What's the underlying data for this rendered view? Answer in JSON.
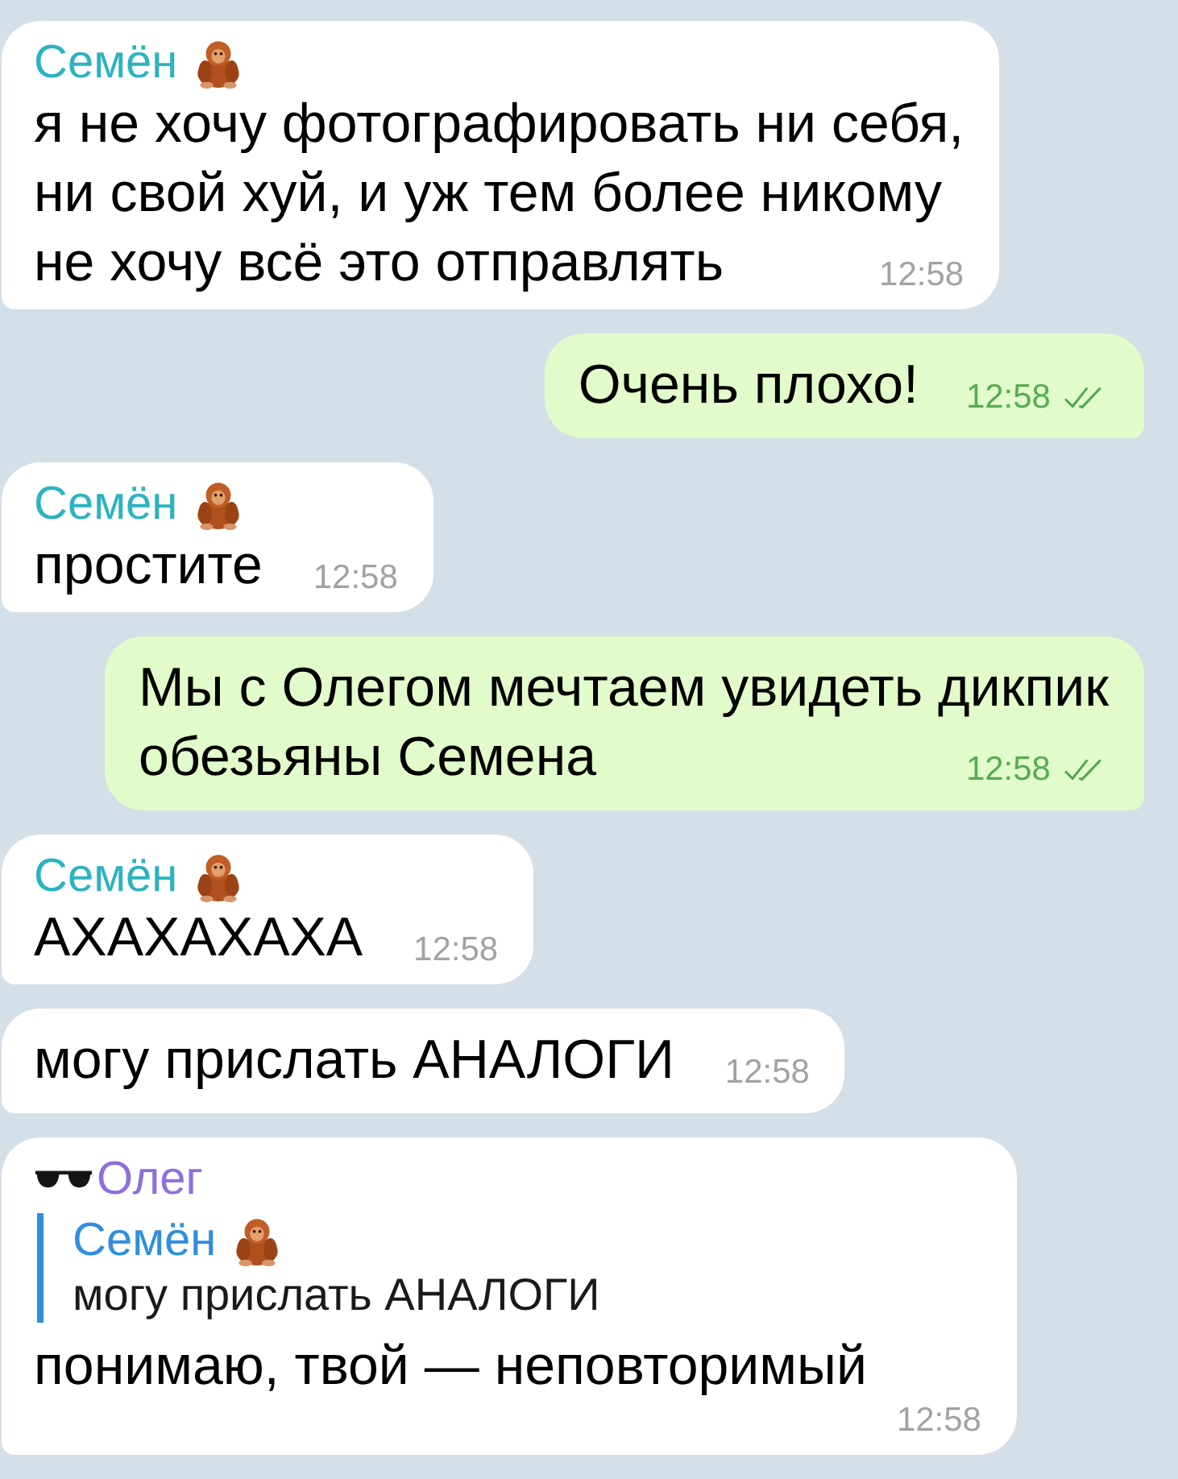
{
  "chat": {
    "messages": [
      {
        "kind": "incoming",
        "sender": {
          "name": "Семён",
          "color": "#2bb3c1",
          "kind": "orangutan"
        },
        "text": "я не хочу фотографировать ни себя,\nни свой хуй, и уж тем более никому\nне хочу всё это отправлять",
        "time": "12:58"
      },
      {
        "kind": "outgoing",
        "text": "Очень плохо!",
        "time": "12:58",
        "read": true
      },
      {
        "kind": "incoming",
        "sender": {
          "name": "Семён",
          "color": "#2bb3c1",
          "kind": "orangutan"
        },
        "text": "простите",
        "time": "12:58"
      },
      {
        "kind": "outgoing",
        "text": "Мы с Олегом мечтаем увидеть дикпик\nобезьяны Семена",
        "time": "12:58",
        "read": true
      },
      {
        "kind": "incoming",
        "sender": {
          "name": "Семён",
          "color": "#2bb3c1",
          "kind": "orangutan"
        },
        "text": "АХАХАХАХА",
        "time": "12:58"
      },
      {
        "kind": "incoming",
        "text": "могу прислать АНАЛОГИ",
        "time": "12:58"
      },
      {
        "kind": "incoming",
        "sender": {
          "name": "Олег",
          "color": "#8e6ee0",
          "kind": "sunglasses"
        },
        "reply": {
          "sender": {
            "name": "Семён",
            "color": "#2f8ede",
            "kind": "orangutan"
          },
          "text": "могу прислать АНАЛОГИ"
        },
        "text": "понимаю, твой — неповторимый",
        "time": "12:58"
      }
    ]
  }
}
